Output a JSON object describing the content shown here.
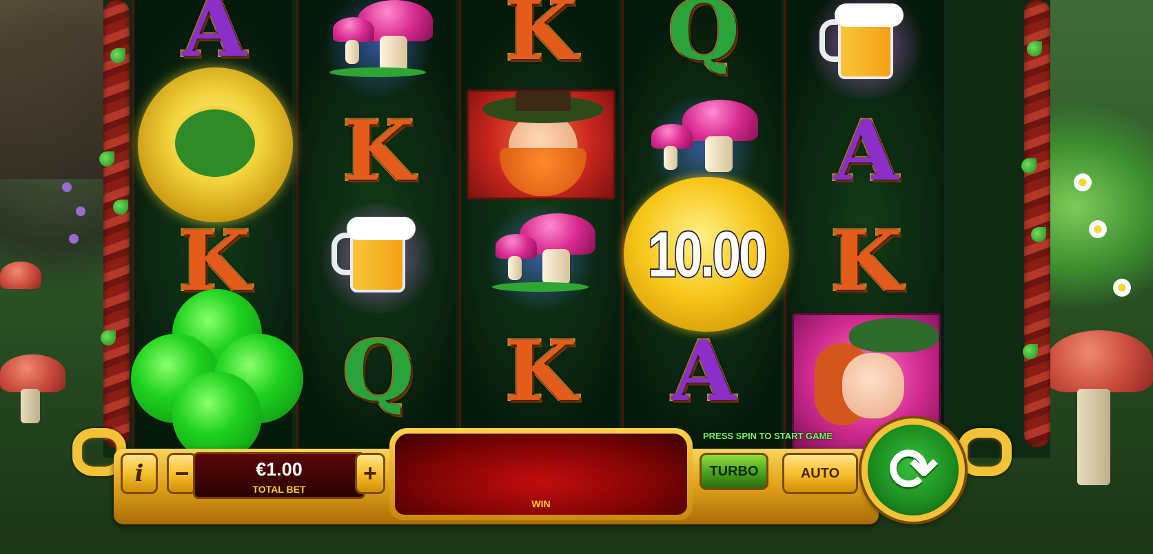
{
  "reels": {
    "win_coin_value": "10.00",
    "symbols": {
      "A": "A",
      "K": "K",
      "Q": "Q"
    }
  },
  "controls": {
    "info_label": "i",
    "minus_label": "−",
    "plus_label": "+",
    "total_bet_value": "€1.00",
    "total_bet_label": "TOTAL BET",
    "win_label": "WIN",
    "status_message": "PRESS SPIN TO START GAME",
    "turbo_label": "TURBO",
    "auto_label": "AUTO",
    "spin_icon": "⟳"
  },
  "colors": {
    "spin_green": "#1b8a1f",
    "gold": "#f2c237",
    "win_panel_red": "#c40d0d",
    "status_text_green": "#6bff5a"
  },
  "icons": {
    "info": "info-icon",
    "spin": "refresh-icon"
  }
}
